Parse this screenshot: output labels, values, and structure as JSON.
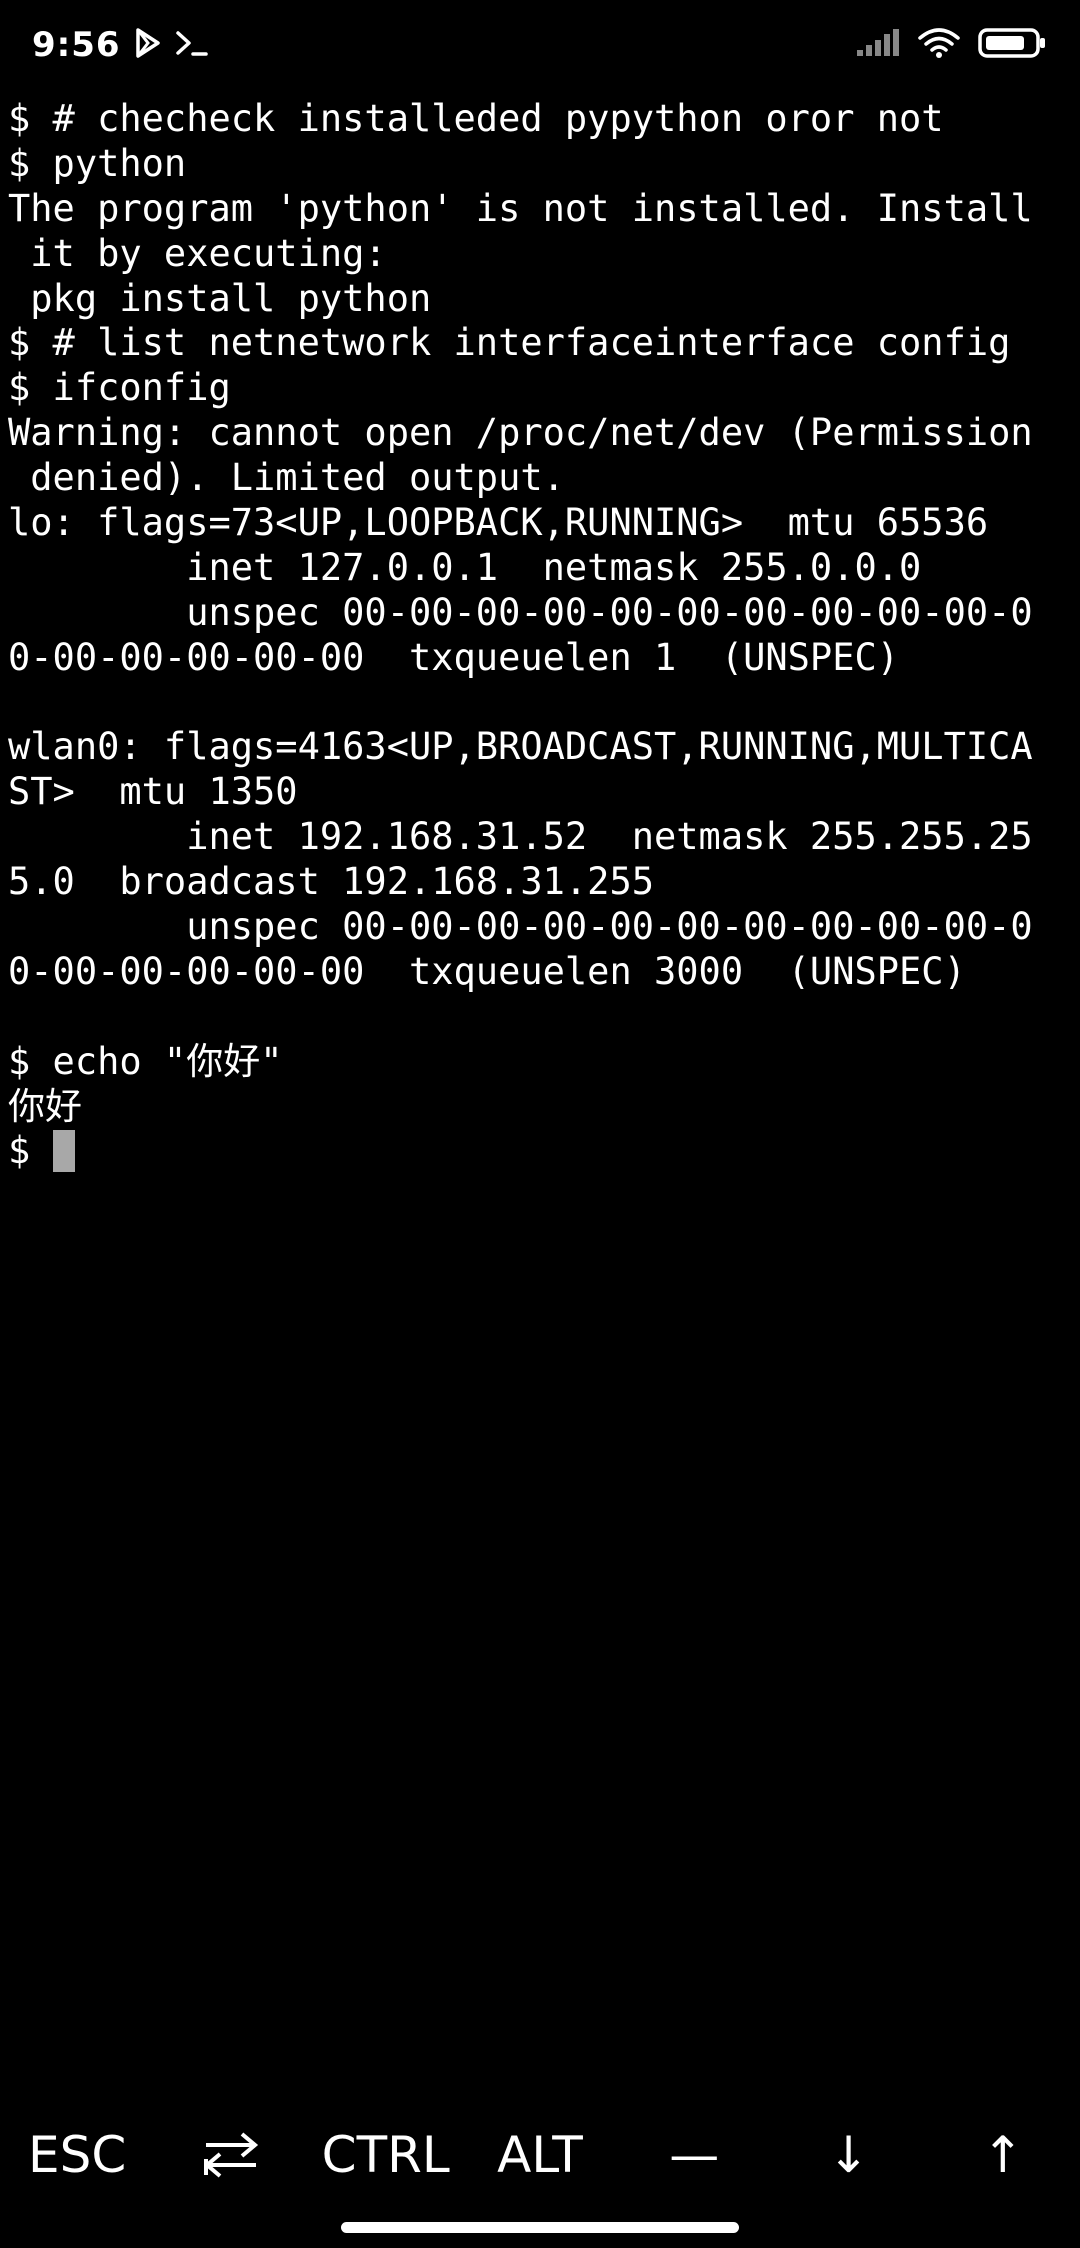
{
  "status_bar": {
    "time": "9:56",
    "icons": [
      "play-store-icon",
      "terminal-prompt-icon",
      "signal-icon",
      "wifi-icon",
      "battery-icon"
    ]
  },
  "terminal": {
    "lines": [
      "$ # checheck installeded pypython oror not",
      "$ python",
      "The program 'python' is not installed. Install",
      " it by executing:",
      " pkg install python",
      "$ # list netnetwork interfaceinterface config",
      "$ ifconfig",
      "Warning: cannot open /proc/net/dev (Permission",
      " denied). Limited output.",
      "lo: flags=73<UP,LOOPBACK,RUNNING>  mtu 65536",
      "        inet 127.0.0.1  netmask 255.0.0.0",
      "        unspec 00-00-00-00-00-00-00-00-00-00-0",
      "0-00-00-00-00-00  txqueuelen 1  (UNSPEC)",
      "",
      "wlan0: flags=4163<UP,BROADCAST,RUNNING,MULTICA",
      "ST>  mtu 1350",
      "        inet 192.168.31.52  netmask 255.255.25",
      "5.0  broadcast 192.168.31.255",
      "        unspec 00-00-00-00-00-00-00-00-00-00-0",
      "0-00-00-00-00-00  txqueuelen 3000  (UNSPEC)",
      "",
      "$ echo \"你好\"",
      "你好"
    ],
    "prompt": "$ ",
    "cursor_color": "#a8a8a8",
    "background": "#000000",
    "foreground": "#ffffff"
  },
  "extra_keys": {
    "esc": "ESC",
    "tab_icon": "tab-arrows-icon",
    "ctrl": "CTRL",
    "alt": "ALT",
    "dash": "—",
    "down": "↓",
    "up": "↑"
  }
}
